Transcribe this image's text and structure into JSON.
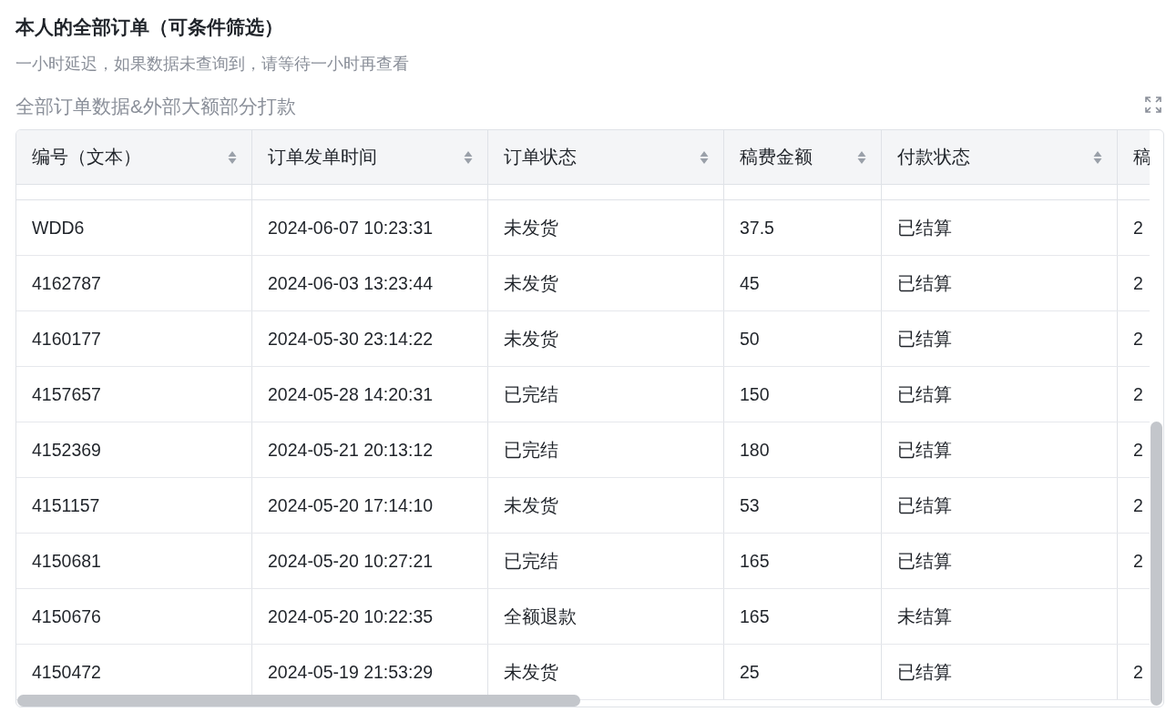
{
  "header": {
    "title": "本人的全部订单（可条件筛选）",
    "subtitle": "一小时延迟，如果数据未查询到，请等待一小时再查看"
  },
  "section": {
    "title": "全部订单数据&外部大额部分打款"
  },
  "table": {
    "columns": [
      {
        "label": "编号（文本）",
        "sortable": true
      },
      {
        "label": "订单发单时间",
        "sortable": true
      },
      {
        "label": "订单状态",
        "sortable": true
      },
      {
        "label": "稿费金额",
        "sortable": true
      },
      {
        "label": "付款状态",
        "sortable": true
      },
      {
        "label": "稿"
      }
    ],
    "rows": [
      [
        "WDD6",
        "2024-06-07 10:23:31",
        "未发货",
        "37.5",
        "已结算",
        "2"
      ],
      [
        "4162787",
        "2024-06-03 13:23:44",
        "未发货",
        "45",
        "已结算",
        "2"
      ],
      [
        "4160177",
        "2024-05-30 23:14:22",
        "未发货",
        "50",
        "已结算",
        "2"
      ],
      [
        "4157657",
        "2024-05-28 14:20:31",
        "已完结",
        "150",
        "已结算",
        "2"
      ],
      [
        "4152369",
        "2024-05-21 20:13:12",
        "已完结",
        "180",
        "已结算",
        "2"
      ],
      [
        "4151157",
        "2024-05-20 17:14:10",
        "未发货",
        "53",
        "已结算",
        "2"
      ],
      [
        "4150681",
        "2024-05-20 10:27:21",
        "已完结",
        "165",
        "已结算",
        "2"
      ],
      [
        "4150676",
        "2024-05-20 10:22:35",
        "全额退款",
        "165",
        "未结算",
        ""
      ],
      [
        "4150472",
        "2024-05-19 21:53:29",
        "未发货",
        "25",
        "已结算",
        "2"
      ]
    ]
  }
}
